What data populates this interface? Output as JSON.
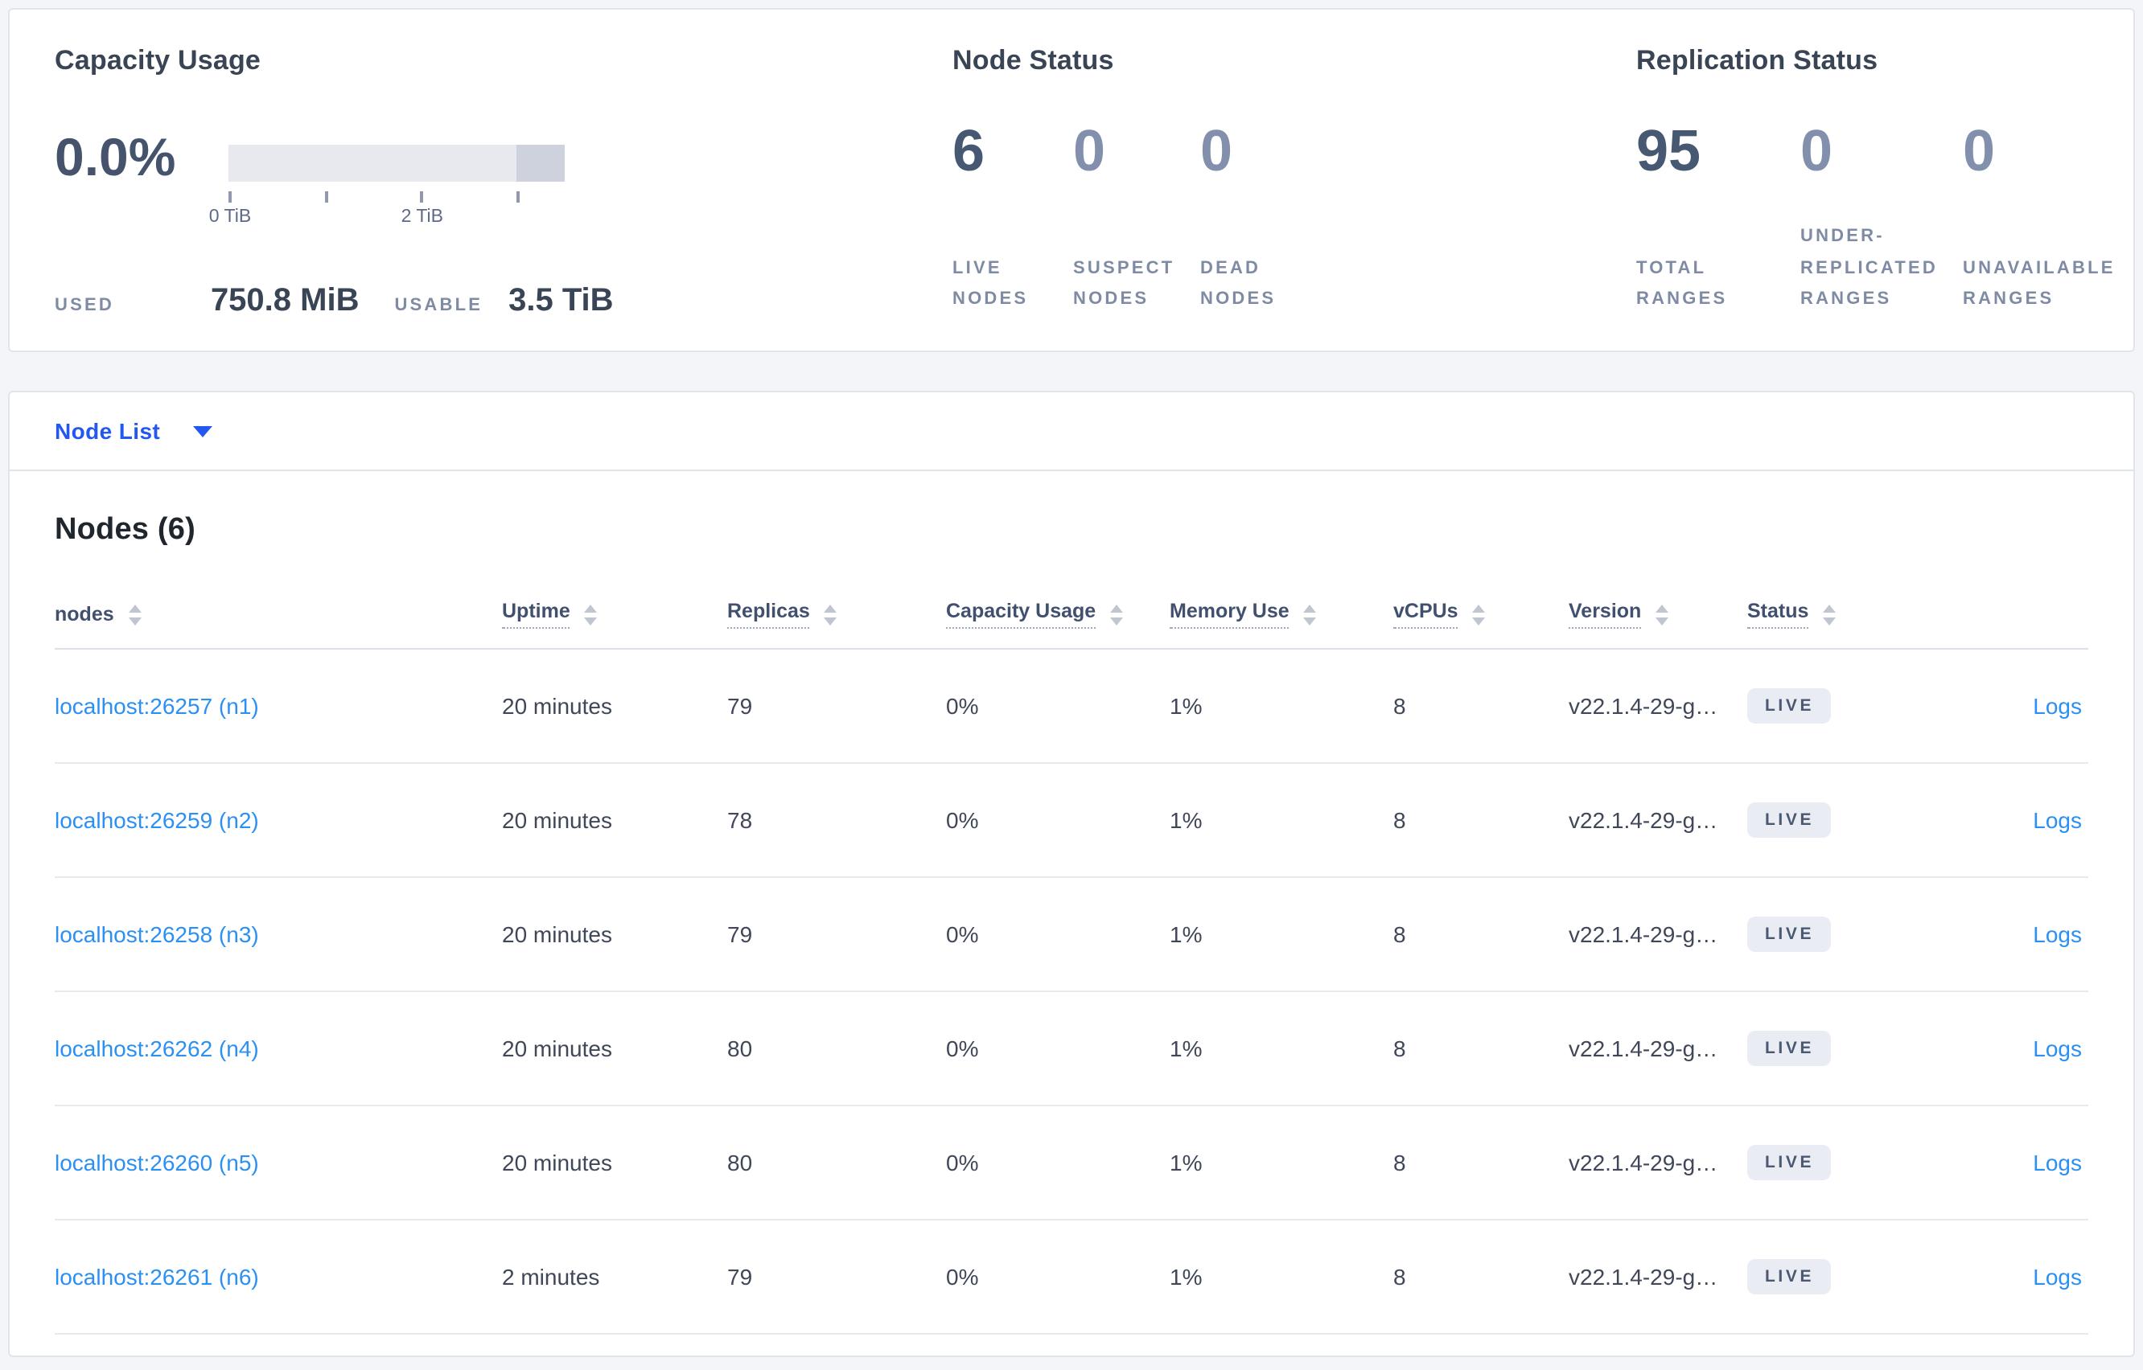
{
  "colors": {
    "page_bg": "#f4f5f9",
    "card_bg": "#ffffff",
    "accent_blue": "#2257f0",
    "link_blue": "#2b90f2",
    "stat_dark": "#475872",
    "stat_muted": "#8290ad",
    "bar_light": "#e8e9ef",
    "bar_dark": "#ced2dd",
    "badge_bg": "#e9edf3",
    "badge_text": "#4a5872"
  },
  "summary": {
    "capacity": {
      "title": "Capacity Usage",
      "percent": "0.0%",
      "used_label": "USED",
      "used_value": "750.8 MiB",
      "usable_label": "USABLE",
      "usable_value": "3.5 TiB",
      "chart": {
        "type": "bar",
        "axis_min": "0 TiB",
        "axis_max": "3.5 TiB",
        "used_fraction": 0.0,
        "usable_boundary_fraction": 0.857,
        "ticks": [
          {
            "label": "0 TiB",
            "pos": 0
          },
          {
            "label": "",
            "pos": 0.2857
          },
          {
            "label": "2 TiB",
            "pos": 0.5714
          },
          {
            "label": "",
            "pos": 0.8571
          }
        ]
      }
    },
    "node_status": {
      "title": "Node Status",
      "stats": [
        {
          "value": "6",
          "label": "LIVE NODES"
        },
        {
          "value": "0",
          "label": "SUSPECT NODES"
        },
        {
          "value": "0",
          "label": "DEAD NODES"
        }
      ]
    },
    "replication": {
      "title": "Replication Status",
      "stats": [
        {
          "value": "95",
          "label": "TOTAL RANGES"
        },
        {
          "value": "0",
          "label": "UNDER-REPLICATED RANGES"
        },
        {
          "value": "0",
          "label": "UNAVAILABLE RANGES"
        }
      ]
    }
  },
  "node_list": {
    "dropdown_label": "Node List"
  },
  "nodes_table": {
    "heading": "Nodes (6)",
    "columns": {
      "nodes": "nodes",
      "uptime": "Uptime",
      "replicas": "Replicas",
      "capacity": "Capacity Usage",
      "memory": "Memory Use",
      "vcpus": "vCPUs",
      "version": "Version",
      "status": "Status"
    },
    "rows": [
      {
        "node": "localhost:26257 (n1)",
        "uptime": "20 minutes",
        "replicas": "79",
        "capacity": "0%",
        "memory": "1%",
        "vcpus": "8",
        "version": "v22.1.4-29-g…",
        "status": "LIVE",
        "logs": "Logs"
      },
      {
        "node": "localhost:26259 (n2)",
        "uptime": "20 minutes",
        "replicas": "78",
        "capacity": "0%",
        "memory": "1%",
        "vcpus": "8",
        "version": "v22.1.4-29-g…",
        "status": "LIVE",
        "logs": "Logs"
      },
      {
        "node": "localhost:26258 (n3)",
        "uptime": "20 minutes",
        "replicas": "79",
        "capacity": "0%",
        "memory": "1%",
        "vcpus": "8",
        "version": "v22.1.4-29-g…",
        "status": "LIVE",
        "logs": "Logs"
      },
      {
        "node": "localhost:26262 (n4)",
        "uptime": "20 minutes",
        "replicas": "80",
        "capacity": "0%",
        "memory": "1%",
        "vcpus": "8",
        "version": "v22.1.4-29-g…",
        "status": "LIVE",
        "logs": "Logs"
      },
      {
        "node": "localhost:26260 (n5)",
        "uptime": "20 minutes",
        "replicas": "80",
        "capacity": "0%",
        "memory": "1%",
        "vcpus": "8",
        "version": "v22.1.4-29-g…",
        "status": "LIVE",
        "logs": "Logs"
      },
      {
        "node": "localhost:26261 (n6)",
        "uptime": "2 minutes",
        "replicas": "79",
        "capacity": "0%",
        "memory": "1%",
        "vcpus": "8",
        "version": "v22.1.4-29-g…",
        "status": "LIVE",
        "logs": "Logs"
      }
    ]
  }
}
